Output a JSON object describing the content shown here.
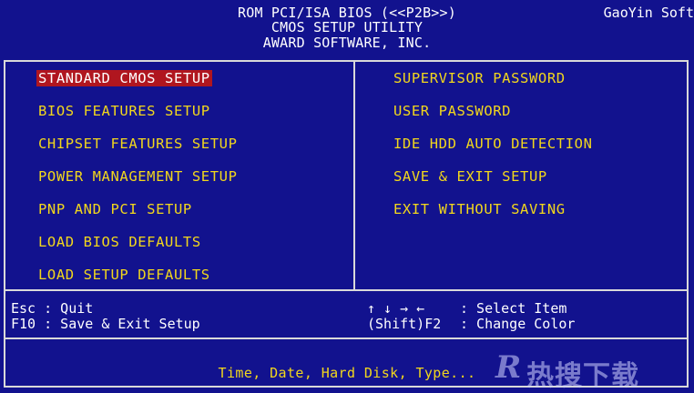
{
  "header": {
    "line1": "ROM PCI/ISA BIOS (<<P2B>>)",
    "line2": "CMOS SETUP UTILITY",
    "line3": "AWARD SOFTWARE, INC.",
    "brand": "GaoYin Soft"
  },
  "menu": {
    "left": [
      "STANDARD CMOS SETUP",
      "BIOS FEATURES SETUP",
      "CHIPSET FEATURES SETUP",
      "POWER MANAGEMENT SETUP",
      "PNP AND PCI SETUP",
      "LOAD BIOS DEFAULTS",
      "LOAD SETUP DEFAULTS"
    ],
    "right": [
      "SUPERVISOR PASSWORD",
      "USER PASSWORD",
      "IDE HDD AUTO DETECTION",
      "SAVE & EXIT SETUP",
      "EXIT WITHOUT SAVING"
    ],
    "selected": "STANDARD CMOS SETUP"
  },
  "help": {
    "esc": "Esc : Quit",
    "f10": "F10 : Save & Exit Setup",
    "arrows": "↑ ↓ → ←",
    "select": ": Select Item",
    "shift_f2": "(Shift)F2",
    "change_color": ": Change Color"
  },
  "description": "Time, Date, Hard Disk, Type...",
  "watermark": {
    "letter": "R",
    "text": "热搜下载"
  },
  "colors": {
    "background": "#12128e",
    "menu_text": "#f2d71c",
    "selection": "#b0161f",
    "frame": "#d9d9d9"
  }
}
